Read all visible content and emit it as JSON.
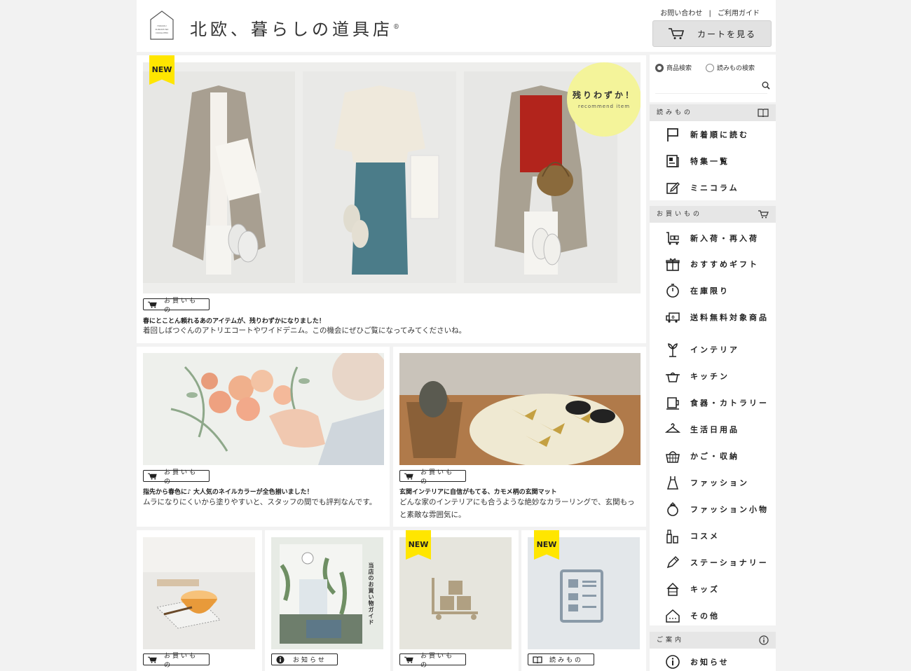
{
  "header": {
    "site_title": "北欧、暮らしの道具店",
    "registered": "®",
    "logo_text": "HOKUOU KURASHI NO DOUGUTEN",
    "utility_contact": "お問い合わせ",
    "utility_sep": "|",
    "utility_guide": "ご利用ガイド",
    "cart_label": "カートを見る"
  },
  "hero": {
    "badge": "NEW",
    "circle_title": "残りわずか！",
    "circle_sub": "recommend item",
    "tag": "お買いもの",
    "title": "春にとことん頼れるあのアイテムが、残りわずかになりました！",
    "body": "着回しばつぐんのアトリエコートやワイドデニム。この機会にぜひご覧になってみてくださいね。"
  },
  "mid_left": {
    "tag": "お買いもの",
    "title": "指先から春色に♪ 大人気のネイルカラーが全色揃いました！",
    "body": "ムラになりにくいから塗りやすいと、スタッフの間でも評判なんです。"
  },
  "mid_right": {
    "tag": "お買いもの",
    "title": "玄関インテリアに自信がもてる、カモメ柄の玄関マット",
    "body": "どんな家のインテリアにも合うような絶妙なカラーリングで、玄関もっと素敵な雰囲気に。"
  },
  "bottom": [
    {
      "tag": "お買いもの"
    },
    {
      "tag": "お知らせ",
      "vertical": "当店のお買い物ガイド"
    },
    {
      "tag": "お買いもの",
      "badge": "NEW"
    },
    {
      "tag": "読みもの",
      "badge": "NEW"
    }
  ],
  "search": {
    "radio_products": "商品検索",
    "radio_articles": "読みもの検索",
    "placeholder": ""
  },
  "sidebar": {
    "reading_head": "読みもの",
    "reading_items": [
      {
        "label": "新着順に読む",
        "icon": "flag-icon"
      },
      {
        "label": "特集一覧",
        "icon": "newspaper-icon"
      },
      {
        "label": "ミニコラム",
        "icon": "pencil-note-icon"
      }
    ],
    "shop_head": "お買いもの",
    "shop_items": [
      {
        "label": "新入荷・再入荷",
        "icon": "cart-box-icon"
      },
      {
        "label": "おすすめギフト",
        "icon": "gift-icon"
      },
      {
        "label": "在庫限り",
        "icon": "stopwatch-icon"
      },
      {
        "label": "送料無料対象商品",
        "icon": "truck-icon"
      },
      {
        "label": "インテリア",
        "icon": "plant-icon"
      },
      {
        "label": "キッチン",
        "icon": "pot-icon"
      },
      {
        "label": "食器・カトラリー",
        "icon": "cup-icon"
      },
      {
        "label": "生活日用品",
        "icon": "hanger-icon"
      },
      {
        "label": "かご・収納",
        "icon": "basket-icon"
      },
      {
        "label": "ファッション",
        "icon": "dress-icon"
      },
      {
        "label": "ファッション小物",
        "icon": "ring-icon"
      },
      {
        "label": "コスメ",
        "icon": "cosmetics-icon"
      },
      {
        "label": "ステーショナリー",
        "icon": "pen-icon"
      },
      {
        "label": "キッズ",
        "icon": "kids-icon"
      },
      {
        "label": "その他",
        "icon": "house-icon"
      }
    ],
    "info_head": "ご案内",
    "info_items": [
      {
        "label": "お知らせ",
        "icon": "info-icon"
      }
    ]
  },
  "colors": {
    "badge_yellow": "#ffe600",
    "circle_yellow": "#f4f49a",
    "section_gray": "#e6e6e6"
  }
}
